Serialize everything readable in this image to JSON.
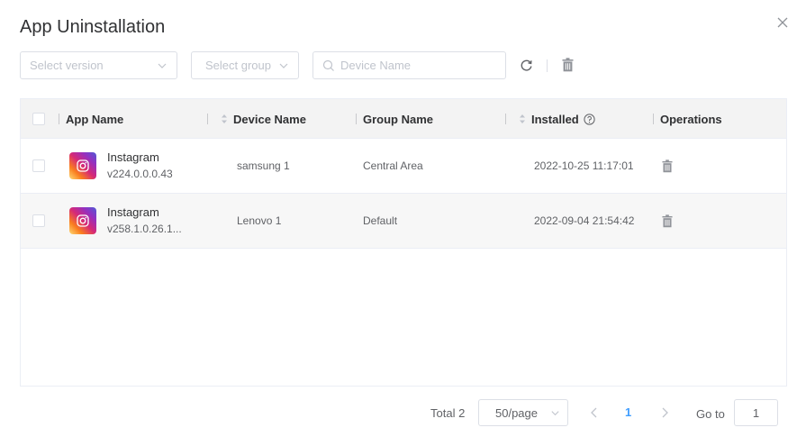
{
  "dialog": {
    "title": "App Uninstallation"
  },
  "toolbar": {
    "version_placeholder": "Select version",
    "group_placeholder": "Select group",
    "search_placeholder": "Device Name",
    "search_value": ""
  },
  "table": {
    "columns": {
      "app_name": "App Name",
      "device_name": "Device Name",
      "group_name": "Group Name",
      "installed": "Installed",
      "operations": "Operations"
    },
    "rows": [
      {
        "app_name": "Instagram",
        "app_version": "v224.0.0.0.43",
        "device_name": "samsung 1",
        "group_name": "Central Area",
        "installed": "2022-10-25 11:17:01",
        "icon": "instagram-icon"
      },
      {
        "app_name": "Instagram",
        "app_version": "v258.1.0.26.1...",
        "device_name": "Lenovo 1",
        "group_name": "Default",
        "installed": "2022-09-04 21:54:42",
        "icon": "instagram-icon"
      }
    ]
  },
  "pagination": {
    "total_label": "Total 2",
    "page_size": "50/page",
    "current_page": "1",
    "goto_label": "Go to",
    "goto_value": "1"
  },
  "colors": {
    "accent": "#409eff",
    "header_bg": "#f3f3f3",
    "row_alt_bg": "#f7f7f7",
    "icon_gray": "#909399"
  }
}
